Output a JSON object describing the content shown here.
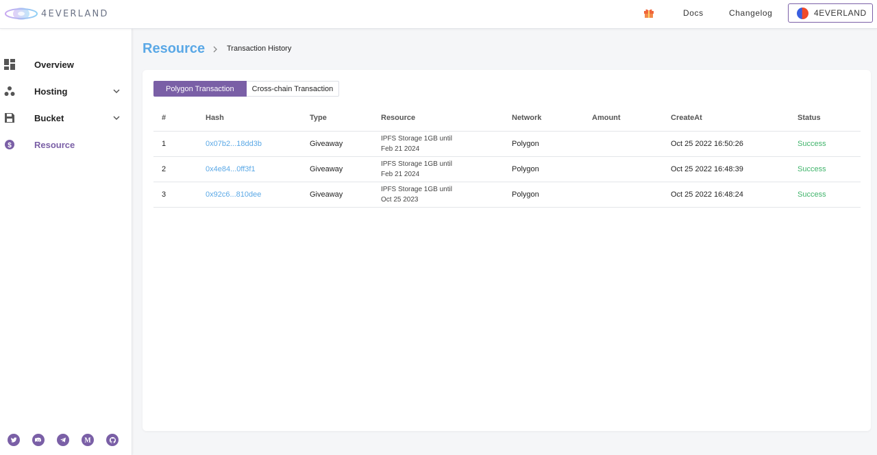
{
  "header": {
    "logo_text": "4EVERLAND",
    "docs_label": "Docs",
    "changelog_label": "Changelog",
    "account_label": "4EVERLAND"
  },
  "sidebar": {
    "items": [
      {
        "label": "Overview",
        "icon": "dashboard-icon"
      },
      {
        "label": "Hosting",
        "icon": "hosting-icon"
      },
      {
        "label": "Bucket",
        "icon": "bucket-icon"
      },
      {
        "label": "Resource",
        "icon": "dollar-icon"
      }
    ],
    "socials": [
      "twitter-icon",
      "discord-icon",
      "telegram-icon",
      "medium-icon",
      "github-icon"
    ]
  },
  "page": {
    "title": "Resource",
    "breadcrumb": "Transaction History"
  },
  "tabs": {
    "polygon": "Polygon Transaction",
    "crosschain": "Cross-chain Transaction"
  },
  "table": {
    "headers": [
      "#",
      "Hash",
      "Type",
      "Resource",
      "Network",
      "Amount",
      "CreateAt",
      "Status"
    ],
    "rows": [
      {
        "num": "1",
        "hash": "0x07b2...18dd3b",
        "type": "Giveaway",
        "resource_line1": "IPFS Storage 1GB until",
        "resource_line2": "Feb 21 2024",
        "network": "Polygon",
        "amount": "",
        "created": "Oct 25 2022 16:50:26",
        "status": "Success"
      },
      {
        "num": "2",
        "hash": "0x4e84...0ff3f1",
        "type": "Giveaway",
        "resource_line1": "IPFS Storage 1GB until",
        "resource_line2": "Feb 21 2024",
        "network": "Polygon",
        "amount": "",
        "created": "Oct 25 2022 16:48:39",
        "status": "Success"
      },
      {
        "num": "3",
        "hash": "0x92c6...810dee",
        "type": "Giveaway",
        "resource_line1": "IPFS Storage 1GB until",
        "resource_line2": "Oct 25 2023",
        "network": "Polygon",
        "amount": "",
        "created": "Oct 25 2022 16:48:24",
        "status": "Success"
      }
    ]
  },
  "colors": {
    "accent": "#7a5fa6",
    "title_blue": "#5aa8e6",
    "success": "#3fb36a"
  }
}
